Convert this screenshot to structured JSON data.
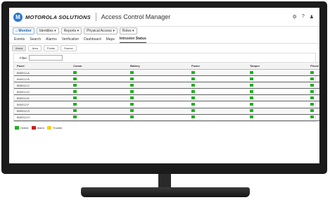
{
  "brand": "MOTOROLA SOLUTIONS",
  "app_title": "Access Control Manager",
  "top_icons": [
    "gear-icon",
    "help-icon",
    "user-icon"
  ],
  "modules": [
    {
      "label": "⌂ Monitor",
      "active": true
    },
    {
      "label": "Identities ▾",
      "active": false
    },
    {
      "label": "Reports ▾",
      "active": false
    },
    {
      "label": "Physical Access ▾",
      "active": false
    },
    {
      "label": "Roles ▾",
      "active": false
    }
  ],
  "tabs": [
    "Events",
    "Search",
    "Alarms",
    "Verification",
    "Dashboard",
    "Maps",
    "Intrusion Status"
  ],
  "active_tab": "Intrusion Status",
  "subtabs": [
    "Areas",
    "Area",
    "Points",
    "Source"
  ],
  "active_subtab": "Areas",
  "filter_label": "Filter:",
  "table": {
    "columns": [
      "Panel",
      "Comm",
      "Battery",
      "Power",
      "Tamper",
      "Phone Line"
    ],
    "rows": [
      {
        "panel": "B00012-A",
        "status": [
          "green",
          "green",
          "green",
          "green",
          "green"
        ]
      },
      {
        "panel": "B00012-B",
        "status": [
          "green",
          "green",
          "green",
          "green",
          "green"
        ]
      },
      {
        "panel": "B00012-C",
        "status": [
          "green",
          "green",
          "green",
          "green",
          "green"
        ]
      },
      {
        "panel": "B00012-D",
        "status": [
          "green",
          "green",
          "green",
          "green",
          "green"
        ]
      },
      {
        "panel": "B00012-E",
        "status": [
          "green",
          "green",
          "green",
          "green",
          "green"
        ]
      },
      {
        "panel": "B00012-F",
        "status": [
          "green",
          "green",
          "green",
          "green",
          "green"
        ]
      },
      {
        "panel": "B00012-G",
        "status": [
          "green",
          "green",
          "green",
          "green",
          "green"
        ]
      },
      {
        "panel": "B00012-H",
        "status": [
          "green",
          "green",
          "green",
          "green",
          "green"
        ]
      }
    ]
  },
  "legend": [
    {
      "label": "Online",
      "color": "#22b022"
    },
    {
      "label": "Alarm",
      "color": "#c81e1e"
    },
    {
      "label": "Trouble",
      "color": "#f2d21a"
    }
  ]
}
